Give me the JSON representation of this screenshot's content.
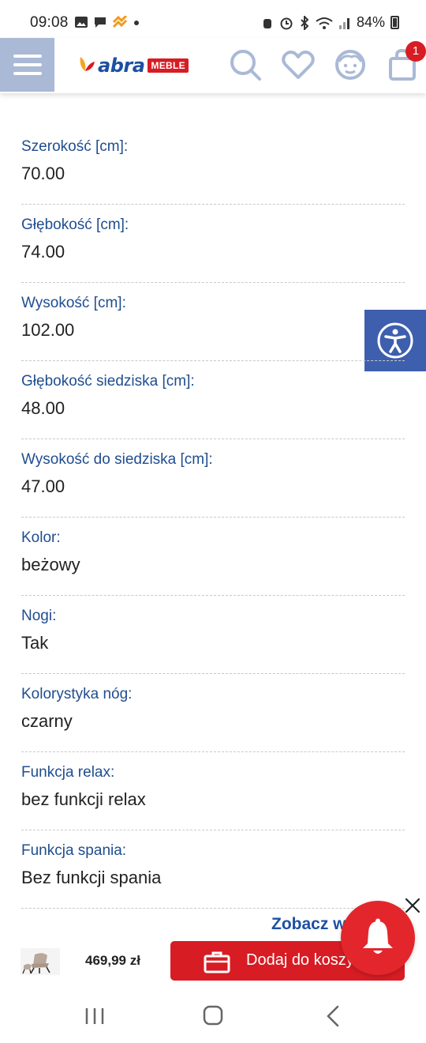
{
  "status_bar": {
    "time": "09:08",
    "battery": "84%"
  },
  "header": {
    "logo_text": "abra",
    "logo_badge": "MEBLE",
    "cart_count": "1",
    "icons": [
      "menu-icon",
      "search-icon",
      "heart-icon",
      "account-icon",
      "cart-icon"
    ]
  },
  "specs": [
    {
      "label": "Szerokość [cm]:",
      "value": "70.00"
    },
    {
      "label": "Głębokość [cm]:",
      "value": "74.00"
    },
    {
      "label": "Wysokość [cm]:",
      "value": "102.00"
    },
    {
      "label": "Głębokość siedziska [cm]:",
      "value": "48.00"
    },
    {
      "label": "Wysokość do siedziska [cm]:",
      "value": "47.00"
    },
    {
      "label": "Kolor:",
      "value": "beżowy"
    },
    {
      "label": "Nogi:",
      "value": "Tak"
    },
    {
      "label": "Kolorystyka nóg:",
      "value": "czarny"
    },
    {
      "label": "Funkcja relax:",
      "value": "bez funkcji relax"
    },
    {
      "label": "Funkcja spania:",
      "value": "Bez funkcji spania"
    }
  ],
  "see_more": "Zobacz w",
  "buy_bar": {
    "price": "469,99 zł",
    "add_label": "Dodaj do koszy"
  },
  "colors": {
    "brand_blue": "#1d4fa3",
    "label_blue": "#1f4d8f",
    "brand_red": "#d71c24",
    "menu_bg": "#a9b9d6",
    "a11y_bg": "#3e5fae"
  }
}
